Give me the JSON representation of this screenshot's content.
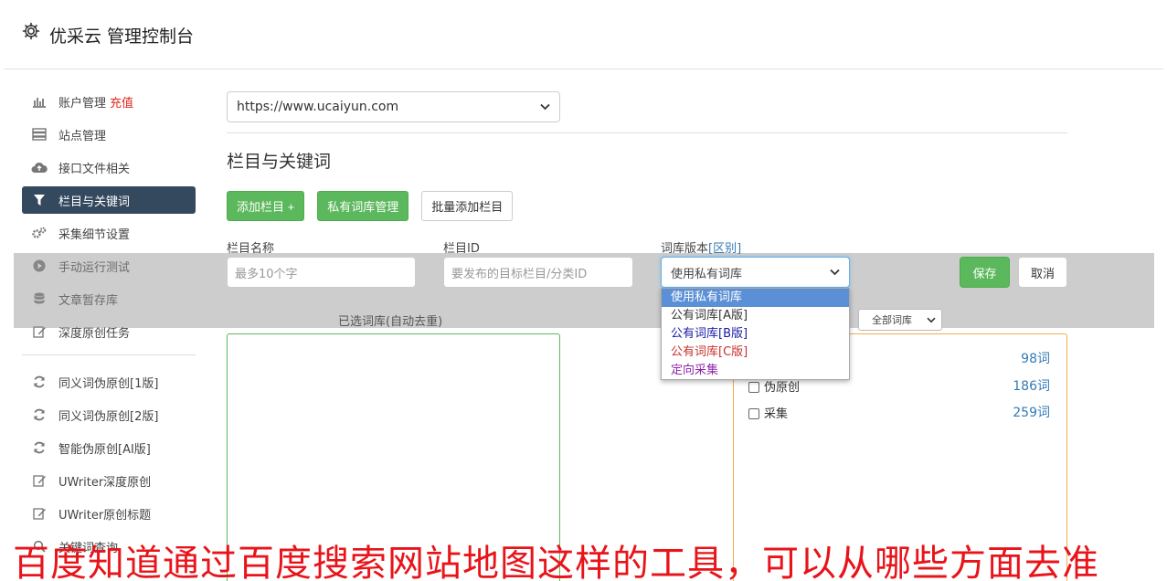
{
  "header": {
    "title": "优采云 管理控制台"
  },
  "sidebar": {
    "items": [
      {
        "label": "账户管理",
        "extra": "充值",
        "icon": "bar-chart-icon"
      },
      {
        "label": "站点管理",
        "icon": "server-icon"
      },
      {
        "label": "接口文件相关",
        "icon": "cloud-upload-icon"
      },
      {
        "label": "栏目与关键词",
        "icon": "filter-icon",
        "active": true
      },
      {
        "label": "采集细节设置",
        "icon": "gears-icon"
      },
      {
        "label": "手动运行测试",
        "icon": "play-icon"
      },
      {
        "label": "文章暂存库",
        "icon": "database-icon"
      },
      {
        "label": "深度原创任务",
        "icon": "edit-icon"
      }
    ],
    "items2": [
      {
        "label": "同义词伪原创[1版]",
        "icon": "refresh-icon"
      },
      {
        "label": "同义词伪原创[2版]",
        "icon": "refresh-icon"
      },
      {
        "label": "智能伪原创[AI版]",
        "icon": "refresh-icon"
      },
      {
        "label": "UWriter深度原创",
        "icon": "edit-icon"
      },
      {
        "label": "UWriter原创标题",
        "icon": "edit-icon"
      },
      {
        "label": "关键词查询",
        "icon": "search-icon"
      }
    ]
  },
  "main": {
    "site_select": "https://www.ucaiyun.com",
    "section_title": "栏目与关键词",
    "buttons": {
      "add_column": "添加栏目 +",
      "private_lib": "私有词库管理",
      "batch_add": "批量添加栏目"
    },
    "form": {
      "name_label": "栏目名称",
      "name_placeholder": "最多10个字",
      "id_label": "栏目ID",
      "id_placeholder": "要发布的目标栏目/分类ID",
      "version_label": "词库版本",
      "version_link": "[区别]",
      "version_selected": "使用私有词库",
      "version_options": [
        {
          "label": "使用私有词库",
          "color": "#ffffff"
        },
        {
          "label": "公有词库[A版]",
          "color": "#333333"
        },
        {
          "label": "公有词库[B版]",
          "color": "#1a1aa6"
        },
        {
          "label": "公有词库[C版]",
          "color": "#c9302c"
        },
        {
          "label": "定向采集",
          "color": "#8e24aa"
        }
      ],
      "save": "保存",
      "cancel": "取消"
    },
    "selected_label": "已选词库(自动去重)",
    "all_libs": "全部词库",
    "libs": [
      {
        "name": "",
        "count": "98词"
      },
      {
        "name": "伪原创",
        "count": "186词"
      },
      {
        "name": "采集",
        "count": "259词"
      }
    ]
  },
  "caption": "百度知道通过百度搜索网站地图这样的工具，可以从哪些方面去准",
  "colors": {
    "green": "#5cb85c",
    "nav_active": "#34495e",
    "link": "#337ab7",
    "caption_red": "#e8141a"
  }
}
